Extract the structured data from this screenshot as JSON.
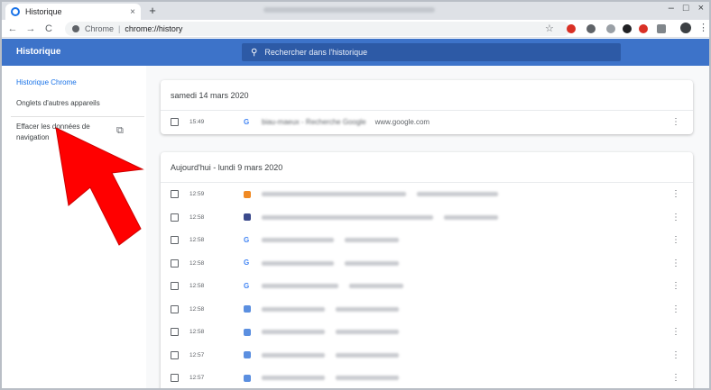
{
  "tab": {
    "title": "Historique",
    "close": "×",
    "new_tab": "+"
  },
  "window": {
    "minimize": "–",
    "maximize": "□",
    "close": "×"
  },
  "toolbar": {
    "back": "←",
    "forward": "→",
    "reload": "C",
    "site_label": "Chrome",
    "url": "chrome://history",
    "star": "☆",
    "menu": "⋮"
  },
  "header": {
    "title": "Historique",
    "search_placeholder": "Rechercher dans l'historique",
    "search_icon": "🔍"
  },
  "sidebar": {
    "items": [
      {
        "label": "Historique Chrome"
      },
      {
        "label": "Onglets d'autres appareils"
      },
      {
        "label": "Effacer les données de"
      },
      {
        "label": "navigation"
      }
    ],
    "external_icon": "⧉"
  },
  "cards": [
    {
      "date": "samedi 14 mars 2020",
      "entries": [
        {
          "time": "15:49",
          "title": "biau-maeux - Recherche Google",
          "domain": "www.google.com",
          "icon": "google-g"
        }
      ]
    },
    {
      "date": "Aujourd'hui - lundi 9 mars 2020",
      "entries": [
        {
          "time": "12:59",
          "icon": "orange"
        },
        {
          "time": "12:58",
          "icon": "blue-dark"
        },
        {
          "time": "12:58",
          "icon": "google-g"
        },
        {
          "time": "12:58",
          "icon": "google-g"
        },
        {
          "time": "12:58",
          "icon": "google-g"
        },
        {
          "time": "12:58",
          "icon": "doc-blue"
        },
        {
          "time": "12:58",
          "icon": "doc-blue"
        },
        {
          "time": "12:57",
          "icon": "doc-blue"
        },
        {
          "time": "12:57",
          "icon": "doc-blue"
        }
      ]
    }
  ],
  "row_menu": "⋮",
  "colors": {
    "header_blue": "#3d73c9",
    "arrow_red": "#ff0000"
  }
}
